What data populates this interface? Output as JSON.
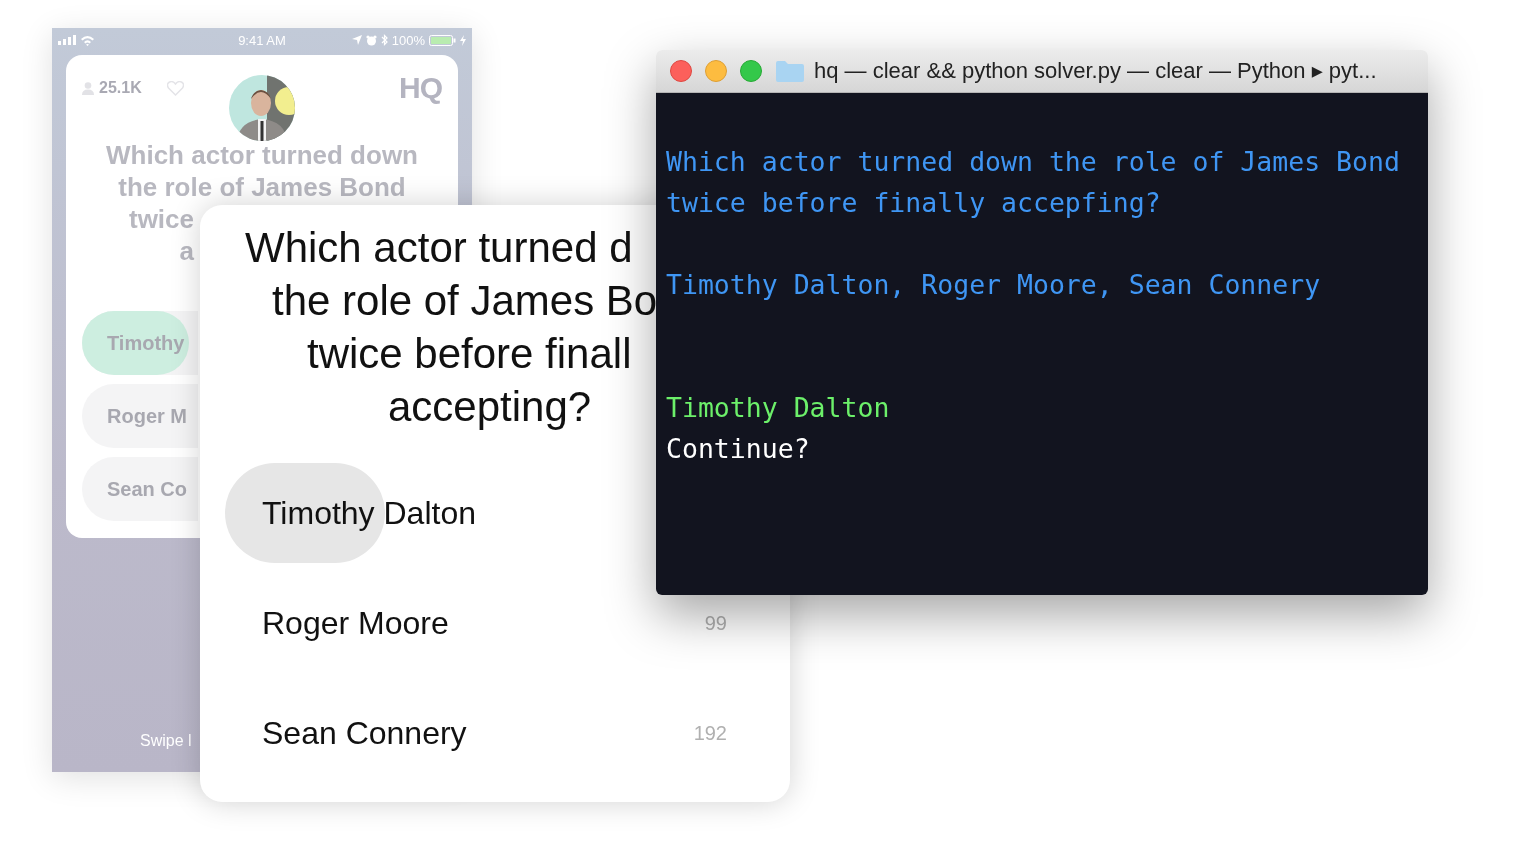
{
  "phone": {
    "status_bar": {
      "time": "9:41 AM",
      "battery": "100%"
    },
    "stats": {
      "viewers": "25.1K",
      "logo": "HQ"
    },
    "question_lines": [
      "Which actor turned down",
      "the role of James Bond",
      "twice",
      "a"
    ],
    "options": [
      {
        "label": "Timothy",
        "selected": true
      },
      {
        "label": "Roger M",
        "selected": false
      },
      {
        "label": "Sean Co",
        "selected": false
      }
    ],
    "hint": "Swipe l"
  },
  "card": {
    "question_lines": [
      "Which actor turned d",
      "the role of James Bo",
      "twice before finall",
      "accepting?"
    ],
    "options": [
      {
        "label": "Timothy Dalton",
        "selected": true
      },
      {
        "label": "Roger Moore",
        "selected": false,
        "count": "99"
      },
      {
        "label": "Sean Connery",
        "selected": false,
        "count": "192"
      }
    ]
  },
  "terminal": {
    "title": "hq — clear && python solver.py — clear — Python ▸ pyt...",
    "lines": [
      {
        "kind": "question",
        "text": "Which actor turned down the role of James Bond twice before finally accepfing?"
      },
      {
        "kind": "options",
        "text": "Timothy Dalton, Roger Moore, Sean Connery"
      },
      {
        "kind": "answer",
        "text": "Timothy Dalton"
      },
      {
        "kind": "prompt",
        "text": "Continue?"
      }
    ]
  }
}
